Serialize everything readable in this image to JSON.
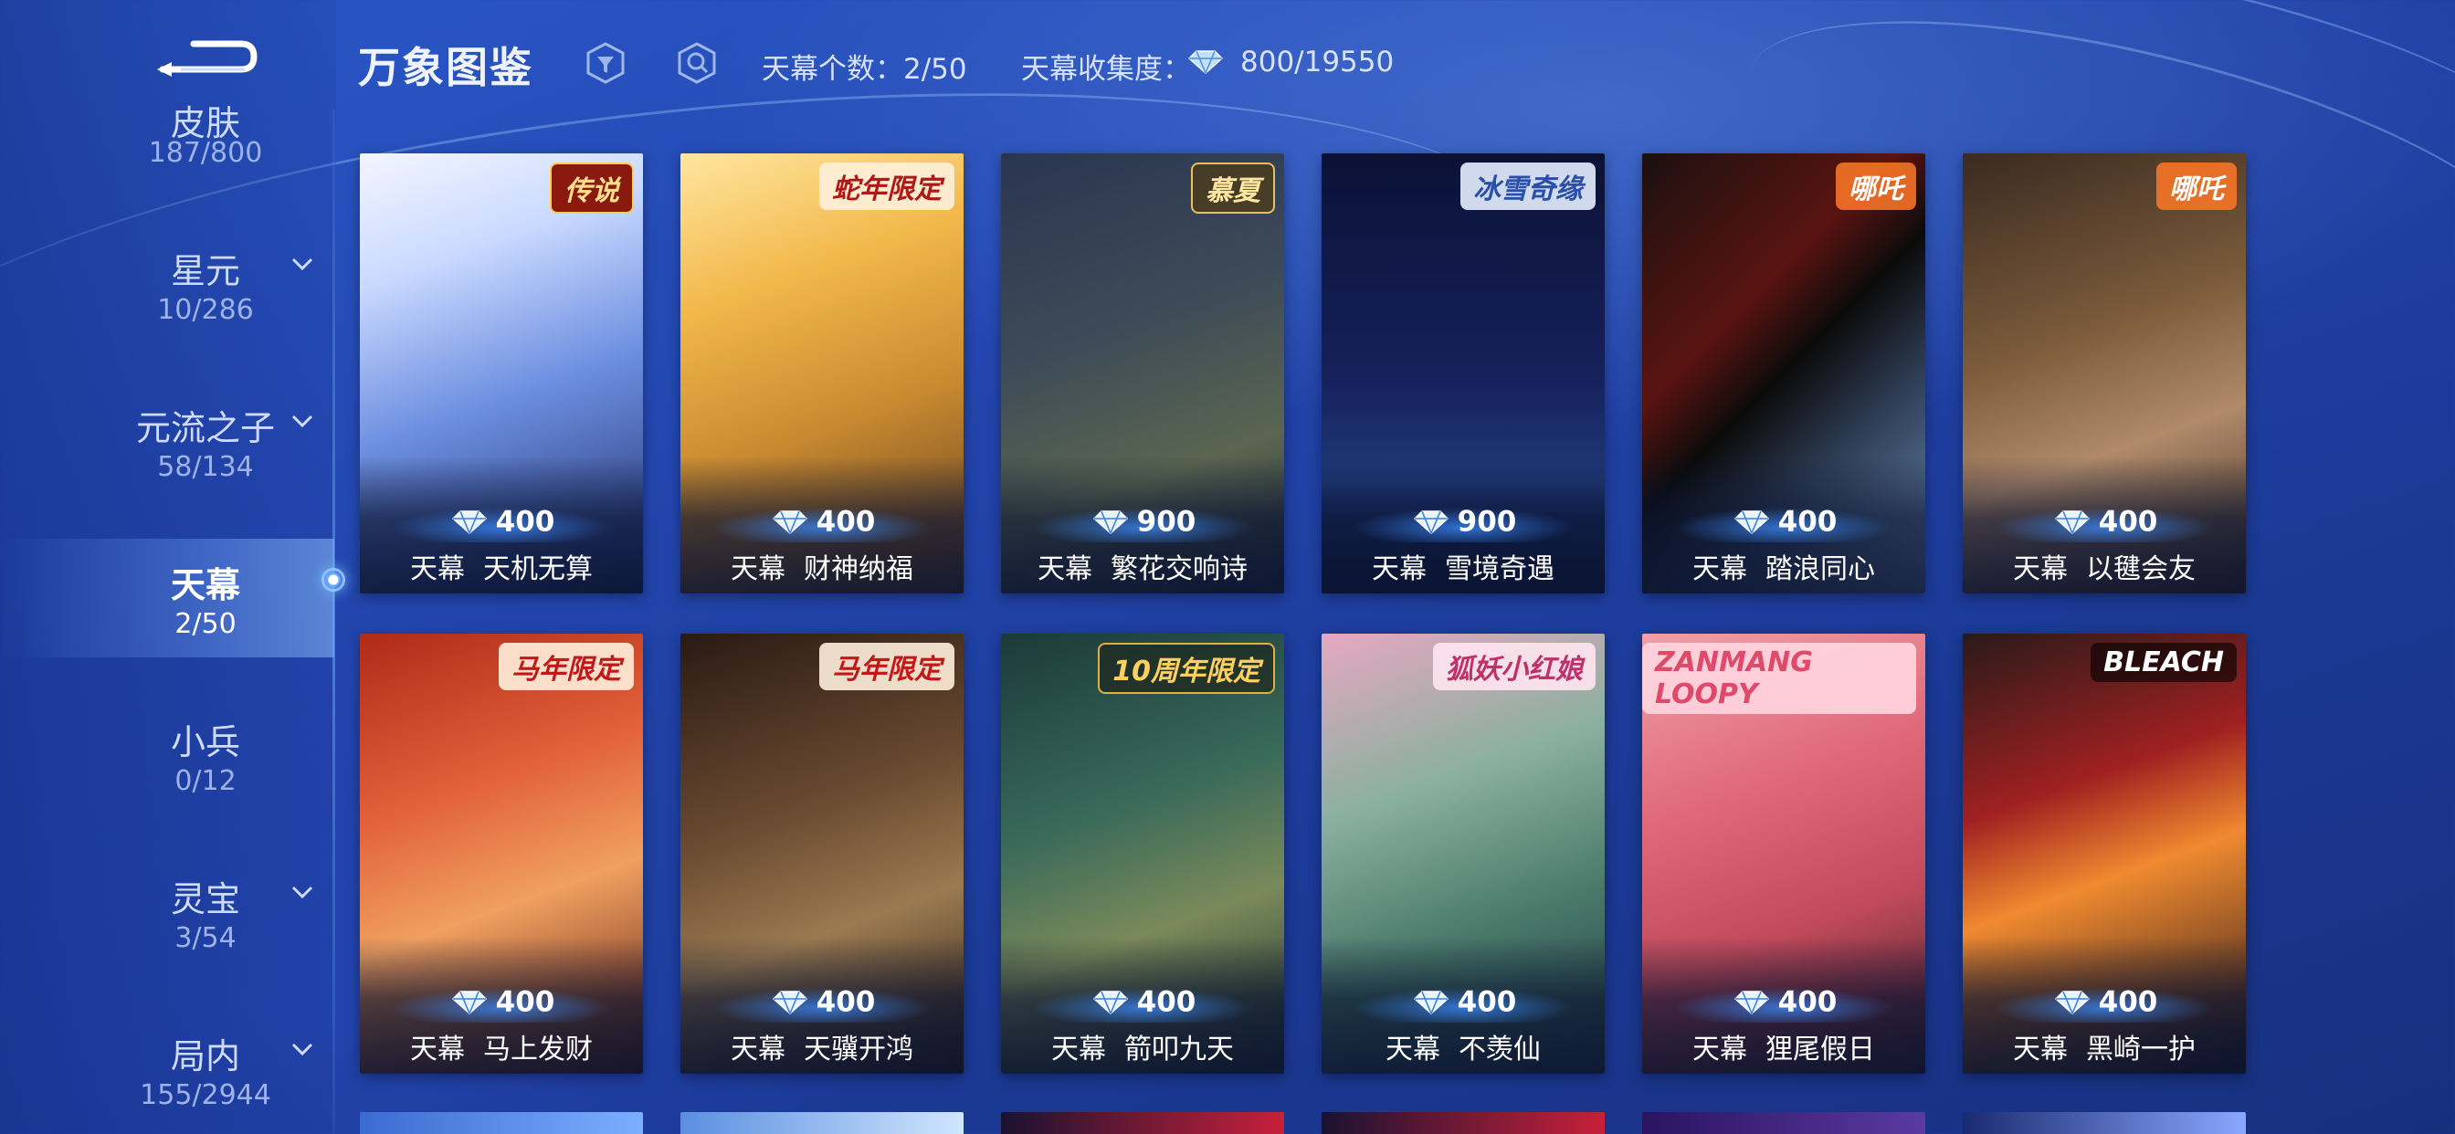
{
  "header": {
    "title": "万象图鉴",
    "icons": [
      "filter-icon",
      "search-icon"
    ],
    "count_label": "天幕个数：2/50",
    "collect_label": "天幕收集度：",
    "collect_value": "800/19550"
  },
  "sidebar": {
    "items": [
      {
        "label": "皮肤",
        "count": "187/800",
        "dropdown": false
      },
      {
        "label": "星元",
        "count": "10/286",
        "dropdown": true
      },
      {
        "label": "元流之子",
        "count": "58/134",
        "dropdown": true
      },
      {
        "label": "天幕",
        "count": "2/50",
        "dropdown": false,
        "active": true
      },
      {
        "label": "小兵",
        "count": "0/12",
        "dropdown": false
      },
      {
        "label": "灵宝",
        "count": "3/54",
        "dropdown": true
      },
      {
        "label": "局内",
        "count": "155/2944",
        "dropdown": true
      }
    ]
  },
  "cards": [
    {
      "type": "天幕",
      "name": "天机无算",
      "price": "400",
      "badge": "传说"
    },
    {
      "type": "天幕",
      "name": "财神纳福",
      "price": "400",
      "badge": "蛇年限定"
    },
    {
      "type": "天幕",
      "name": "繁花交响诗",
      "price": "900",
      "badge": "慕夏"
    },
    {
      "type": "天幕",
      "name": "雪境奇遇",
      "price": "900",
      "badge": "冰雪奇缘"
    },
    {
      "type": "天幕",
      "name": "踏浪同心",
      "price": "400",
      "badge": "哪吒"
    },
    {
      "type": "天幕",
      "name": "以毽会友",
      "price": "400",
      "badge": "哪吒"
    },
    {
      "type": "天幕",
      "name": "马上发财",
      "price": "400",
      "badge": "马年限定"
    },
    {
      "type": "天幕",
      "name": "天骥开鸿",
      "price": "400",
      "badge": "马年限定"
    },
    {
      "type": "天幕",
      "name": "箭叩九天",
      "price": "400",
      "badge": "10周年限定"
    },
    {
      "type": "天幕",
      "name": "不羡仙",
      "price": "400",
      "badge": "狐妖小红娘"
    },
    {
      "type": "天幕",
      "name": "狸尾假日",
      "price": "400",
      "badge": "ZANMANG LOOPY"
    },
    {
      "type": "天幕",
      "name": "黑崎一护",
      "price": "400",
      "badge": "BLEACH"
    }
  ],
  "colors": {
    "accent": "#5aa8ff",
    "background": "#2346ae",
    "active": "#ffffff"
  }
}
